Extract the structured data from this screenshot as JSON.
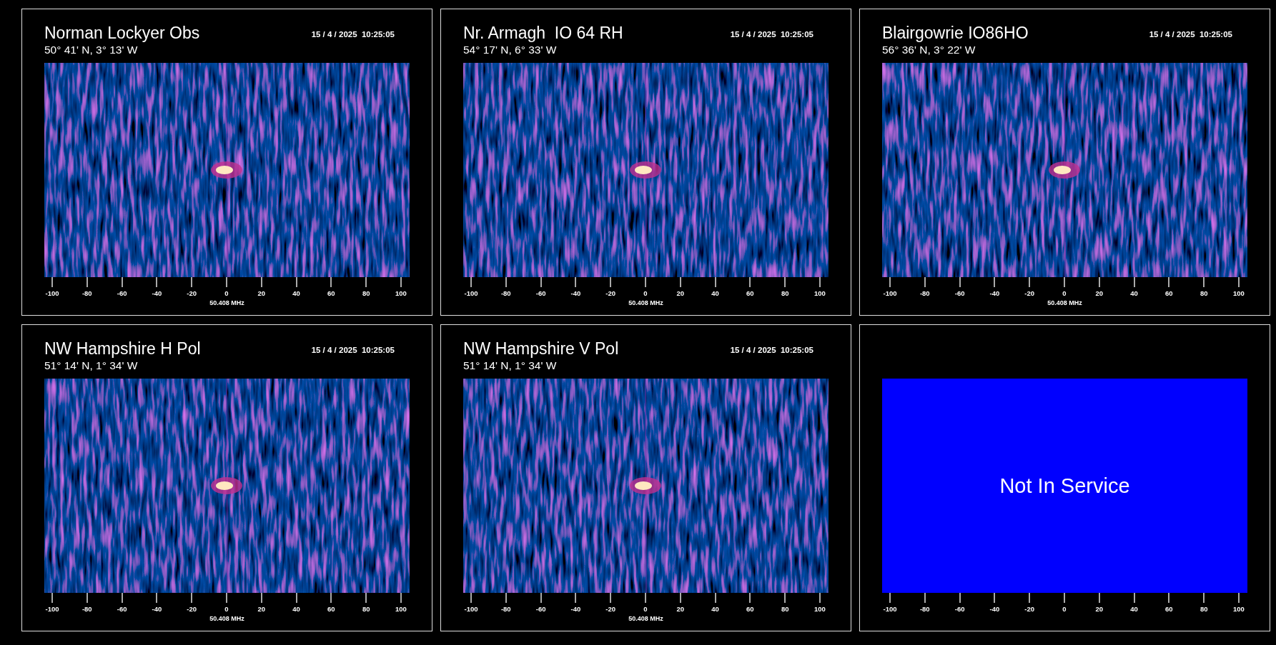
{
  "panels": [
    {
      "kind": "spectrogram",
      "title": "Norman Lockyer Obs",
      "coords": "50° 41' N, 3° 13' W",
      "timestamp": "15 / 4 / 2025  10:25:05",
      "freq_label": "50.408 MHz",
      "ticks": [
        "-100",
        "-80",
        "-60",
        "-40",
        "-20",
        "0",
        "20",
        "40",
        "60",
        "80",
        "100"
      ]
    },
    {
      "kind": "spectrogram",
      "title": "Nr. Armagh  IO 64 RH",
      "coords": "54° 17' N, 6° 33' W",
      "timestamp": "15 / 4 / 2025  10:25:05",
      "freq_label": "50.408 MHz",
      "ticks": [
        "-100",
        "-80",
        "-60",
        "-40",
        "-20",
        "0",
        "20",
        "40",
        "60",
        "80",
        "100"
      ]
    },
    {
      "kind": "spectrogram",
      "title": "Blairgowrie IO86HO",
      "coords": "56° 36' N, 3° 22' W",
      "timestamp": "15 / 4 / 2025  10:25:05",
      "freq_label": "50.408 MHz",
      "ticks": [
        "-100",
        "-80",
        "-60",
        "-40",
        "-20",
        "0",
        "20",
        "40",
        "60",
        "80",
        "100"
      ]
    },
    {
      "kind": "spectrogram",
      "title": "NW Hampshire H Pol",
      "coords": "51° 14' N, 1° 34' W",
      "timestamp": "15 / 4 / 2025  10:25:05",
      "freq_label": "50.408 MHz",
      "ticks": [
        "-100",
        "-80",
        "-60",
        "-40",
        "-20",
        "0",
        "20",
        "40",
        "60",
        "80",
        "100"
      ]
    },
    {
      "kind": "spectrogram",
      "title": "NW Hampshire V Pol",
      "coords": "51° 14' N, 1° 34' W",
      "timestamp": "15 / 4 / 2025  10:25:05",
      "freq_label": "50.408 MHz",
      "ticks": [
        "-100",
        "-80",
        "-60",
        "-40",
        "-20",
        "0",
        "20",
        "40",
        "60",
        "80",
        "100"
      ]
    },
    {
      "kind": "offline",
      "message": "Not In Service",
      "ticks": [
        "-100",
        "-80",
        "-60",
        "-40",
        "-20",
        "0",
        "20",
        "40",
        "60",
        "80",
        "100"
      ]
    }
  ]
}
